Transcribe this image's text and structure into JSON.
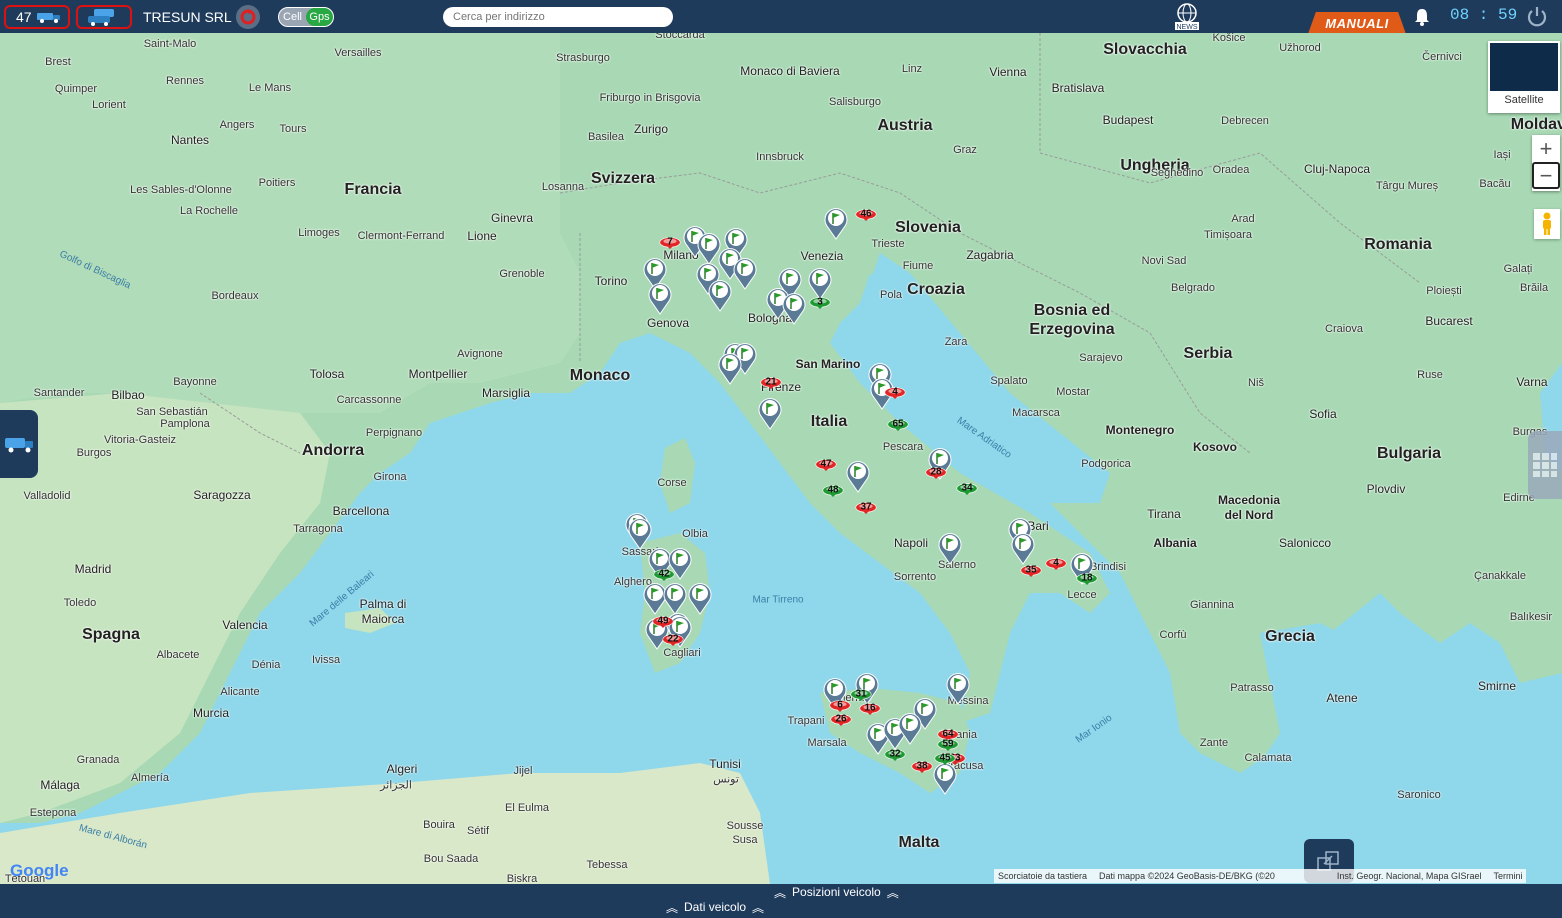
{
  "header": {
    "vehicle_count": "47",
    "company": "TRESUN SRL",
    "toggle_left": "Cell",
    "toggle_right": "Gps",
    "search_placeholder": "Cerca per indirizzo",
    "news_label": "NEWS",
    "manuali_label": "MANUALI",
    "clock_h": "08",
    "clock_m": "59"
  },
  "map_controls": {
    "satellite_label": "Satellite",
    "zoom_in": "+",
    "zoom_out": "−"
  },
  "attribution": {
    "google": "Google",
    "shortcuts": "Scorciatoie da tastiera",
    "data": "Dati mappa ©2024 GeoBasis-DE/BKG (©20",
    "inst": "Inst. Geogr. Nacional, Mapa GISrael",
    "terms": "Termini"
  },
  "bottom": {
    "positions": "Posizioni veicolo",
    "vehicle_data": "Dati veicolo"
  },
  "labels": {
    "countries": [
      "Slovacchia",
      "Austria",
      "Ungheria",
      "Slovenia",
      "Croazia",
      "Bosnia ed",
      "Erzegovina",
      "Serbia",
      "Romania",
      "Svizzera",
      "Francia",
      "Italia",
      "San Marino",
      "Monaco",
      "Andorra",
      "Spagna",
      "Bulgaria",
      "Kosovo",
      "Montenegro",
      "Albania",
      "Macedonia",
      "del Nord",
      "Grecia",
      "Malta",
      "Moldavia"
    ],
    "cities": [
      "Saint-Malo",
      "Brest",
      "Quimper",
      "Lorient",
      "Rennes",
      "Le Mans",
      "Versailles",
      "Angers",
      "Tours",
      "Nantes",
      "Poitiers",
      "Les Sables-d'Olonne",
      "La Rochelle",
      "Limoges",
      "Clermont-Ferrand",
      "Lione",
      "Ginevra",
      "Losanna",
      "Grenoble",
      "Torino",
      "Milano",
      "Genova",
      "Bordeaux",
      "Avignone",
      "Tolosa",
      "Montpellier",
      "Marsiglia",
      "Bayonne",
      "Bilbao",
      "Santander",
      "San Sebastián",
      "Pamplona",
      "Vitoria-Gasteiz",
      "Burgos",
      "Valladolid",
      "Saragozza",
      "Perpignano",
      "Carcassonne",
      "Girona",
      "Barcellona",
      "Tarragona",
      "Madrid",
      "Toledo",
      "Valencia",
      "Albacete",
      "Alicante",
      "Palma di",
      "Maiorca",
      "Ivissa",
      "Dénia",
      "Murcia",
      "Granada",
      "Almería",
      "Málaga",
      "Estepona",
      "Tétouan",
      "Algeri",
      "الجزائر",
      "Tunisi",
      "تونس",
      "Jijel",
      "El Eulma",
      "Bouira",
      "Sétif",
      "Biskra",
      "Bou Saada",
      "Tebessa",
      "Sousse",
      "Susa",
      "Monaco di Baviera",
      "Stoccarda",
      "Strasburgo",
      "Friburgo in Brisgovia",
      "Basilea",
      "Zurigo",
      "Innsbruck",
      "Salisburgo",
      "Linz",
      "Vienna",
      "Bratislava",
      "Budapest",
      "Graz",
      "Trieste",
      "Venezia",
      "Fiume",
      "Zagabria",
      "Pola",
      "Bologna",
      "Firenze",
      "Zara",
      "Spalato",
      "Pescara",
      "Napoli",
      "Salerno",
      "Sorrento",
      "Bari",
      "Brindisi",
      "Lecce",
      "Messina",
      "Palermo",
      "Trapani",
      "Marsala",
      "Siracusa",
      "Catania",
      "Olbia",
      "Sassari",
      "Alghero",
      "Cagliari",
      "Sarajevo",
      "Mostar",
      "Macarsca",
      "Podgorica",
      "Tirana",
      "Belgrado",
      "Novi Sad",
      "Timișoara",
      "Arad",
      "Oradea",
      "Cluj-Napoca",
      "Debrecen",
      "Seghedino",
      "Košice",
      "Užhorod",
      "Černivci",
      "Iași",
      "Bacău",
      "Târgu Mureș",
      "Galați",
      "Brăila",
      "Ploiești",
      "Bucarest",
      "Craiova",
      "Ruse",
      "Varna",
      "Sofia",
      "Plovdiv",
      "Burgas",
      "Niš",
      "Salonicco",
      "Corfù",
      "Giannina",
      "Patrasso",
      "Atene",
      "Zante",
      "Calamata",
      "Smirne",
      "Balıkesir",
      "Çanakkale",
      "Edirne",
      "Saronico"
    ],
    "seas": [
      "Golfo di Biscaglia",
      "Mar Tirreno",
      "Mare Adriatico",
      "Mar Ionio",
      "Mare delle Baleari",
      "Mare di Alborán",
      "Corse"
    ]
  },
  "markers": {
    "red": [
      "46",
      "7",
      "21",
      "4",
      "47",
      "37",
      "28",
      "35",
      "4",
      "49",
      "22",
      "6",
      "16",
      "26",
      "64",
      "63",
      "38"
    ],
    "green": [
      "3",
      "65",
      "48",
      "34",
      "42",
      "18",
      "31",
      "59",
      "32",
      "45"
    ]
  }
}
